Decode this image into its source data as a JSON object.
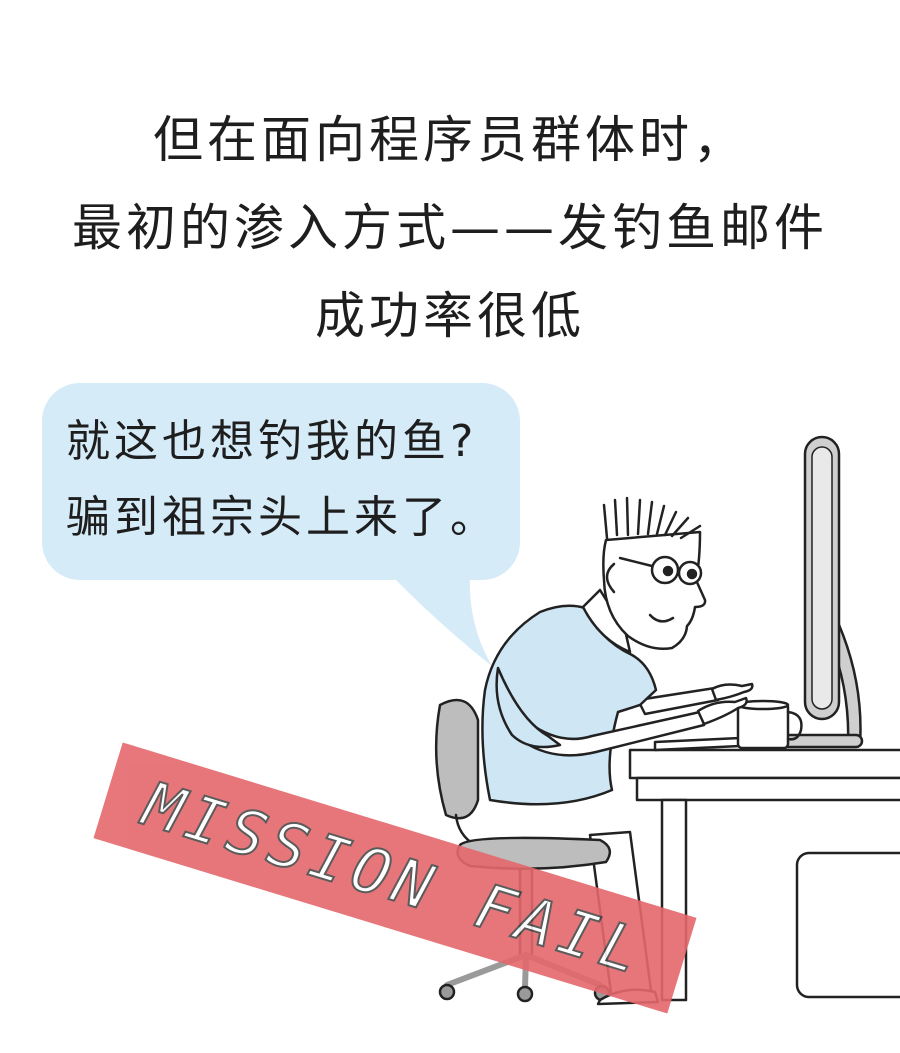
{
  "caption": {
    "lines": [
      "但在面向程序员群体时，",
      "最初的渗入方式——发钓鱼邮件",
      "成功率很低"
    ]
  },
  "bubble": {
    "lines": [
      "就这也想钓我的鱼?",
      "骗到祖宗头上来了。"
    ]
  },
  "stamp": {
    "text": "MISSION FAIL"
  },
  "colors": {
    "background": "#ffffff",
    "bubble": "#d5ebf8",
    "shirt": "#cfe7f5",
    "stamp": "#e4686c",
    "chair": "#bdbdbd",
    "monitor": "#cfcfcf",
    "outline": "#222222"
  }
}
